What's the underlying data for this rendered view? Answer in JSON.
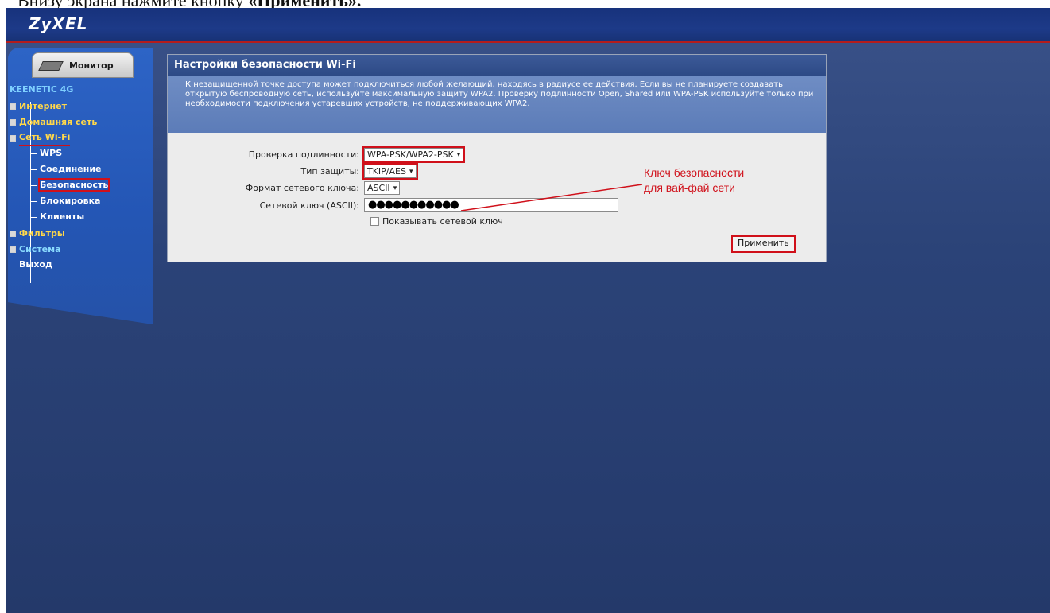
{
  "caption": {
    "text": "Внизу экрана нажмите кнопку ",
    "bold": "«Применить»."
  },
  "header": {
    "logo": "ZyXEL"
  },
  "sidebar": {
    "monitor_label": "Монитор",
    "device": "KEENETIC 4G",
    "items": {
      "internet": "Интернет",
      "home": "Домашняя сеть",
      "wifi": "Сеть Wi-Fi",
      "wps": "WPS",
      "connection": "Соединение",
      "security": "Безопасность",
      "blocking": "Блокировка",
      "clients": "Клиенты",
      "filters": "Фильтры",
      "system": "Система",
      "exit": "Выход"
    }
  },
  "panel": {
    "title": "Настройки безопасности Wi-Fi",
    "description": "К незащищенной точке доступа может подключиться любой желающий, находясь в радиусе ее действия. Если вы не планируете создавать открытую беспроводную сеть, используйте максимальную защиту WPA2. Проверку подлинности Open, Shared или WPA-PSK используйте только при необходимости подключения устаревших устройств, не поддерживающих WPA2.",
    "auth_label": "Проверка подлинности:",
    "auth_value": "WPA-PSK/WPA2-PSK",
    "protection_label": "Тип защиты:",
    "protection_value": "TKIP/AES",
    "key_format_label": "Формат сетевого ключа:",
    "key_format_value": "ASCII",
    "key_label": "Сетевой ключ (ASCII):",
    "key_value": "●●●●●●●●●●●",
    "show_key_label": "Показывать сетевой ключ",
    "apply_label": "Применить"
  },
  "annotation": {
    "line1": "Ключ безопасности",
    "line2": "для вай-фай сети",
    "color": "#d0101a"
  }
}
